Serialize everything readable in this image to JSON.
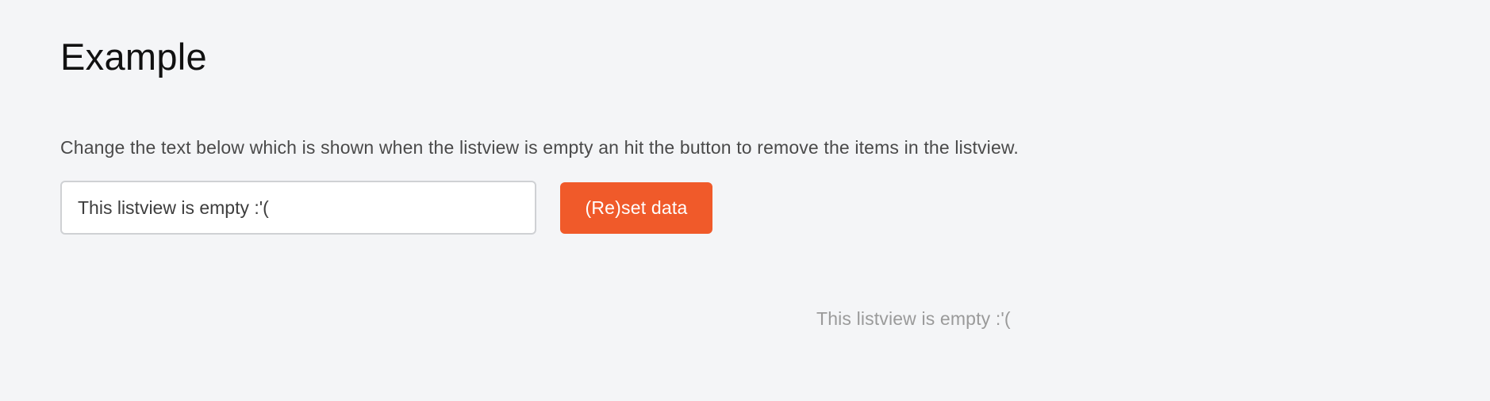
{
  "page": {
    "title": "Example",
    "description": "Change the text below which is shown when the listview is empty an hit the button to remove the items in the listview."
  },
  "controls": {
    "empty_text_input_value": "This listview is empty :'(",
    "reset_button_label": "(Re)set data",
    "accent_color": "#f05a2a"
  },
  "listview": {
    "items": [],
    "empty_text": "This listview is empty :'("
  }
}
